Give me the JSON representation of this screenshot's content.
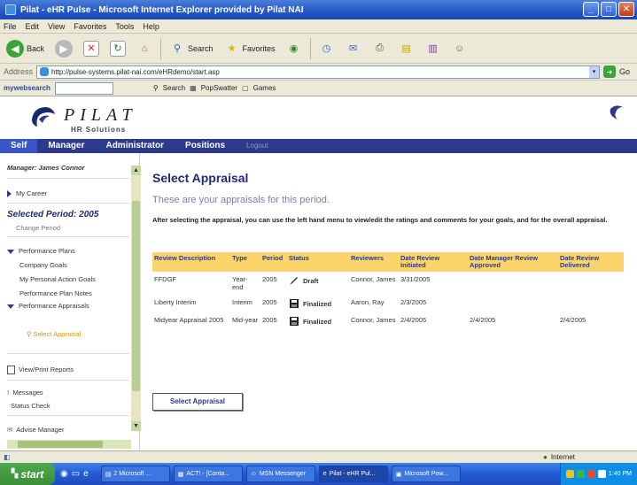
{
  "window": {
    "title": "Pilat - eHR Pulse - Microsoft Internet Explorer provided by Pilat NAI",
    "min_label": "_",
    "max_label": "□",
    "close_label": "✕"
  },
  "menu": [
    "File",
    "Edit",
    "View",
    "Favorites",
    "Tools",
    "Help"
  ],
  "toolbar": {
    "back_label": "Back",
    "search_label": "Search",
    "favorites_label": "Favorites"
  },
  "address": {
    "label": "Address",
    "url": "http://pulse-systems.pilat-nai.com/eHRdemo/start.asp",
    "go_label": "Go"
  },
  "searchbar": {
    "brand": "mywebsearch",
    "search_label": "Search",
    "popswatter_label": "PopSwatter",
    "games_label": "Games"
  },
  "brand": {
    "name": "PILAT",
    "sub": "HR Solutions"
  },
  "nav": {
    "items": [
      "Self",
      "Manager",
      "Administrator",
      "Positions"
    ],
    "logout": "Logout"
  },
  "sidebar": {
    "manager": "Manager: James Connor",
    "my_career": "My Career",
    "selected_period": "Selected Period: 2005",
    "change_period": "Change Period",
    "performance_plans": "Performance Plans",
    "company_goals": "Company Goals",
    "personal_action_goals": "My Personal Action Goals",
    "plan_notes": "Performance Plan Notes",
    "performance_appraisals": "Performance Appraisals",
    "select_appraisal": "Select Appraisal",
    "view_print_reports": "View/Print Reports",
    "messages": "Messages",
    "status_check": "Status Check",
    "advise_manager": "Advise Manager"
  },
  "main": {
    "title": "Select Appraisal",
    "subtitle": "These are your appraisals for this period.",
    "instructions": "After selecting the appraisal, you can use the left hand menu to view/edit the ratings and comments for your goals, and for the overall appraisal.",
    "columns": [
      "Review Description",
      "Type",
      "Period",
      "Status",
      "Reviewers",
      "Date Review Initiated",
      "Date Manager Review Approved",
      "Date Review Delivered"
    ],
    "rows": [
      {
        "description": "FFDGF",
        "type": "Year-end",
        "period": "2005",
        "status": "Draft",
        "status_icon": "pencil-icon",
        "reviewers": "Connor, James",
        "initiated": "3/31/2005",
        "approved": "",
        "delivered": ""
      },
      {
        "description": "Liberty Interim",
        "type": "Interim",
        "period": "2005",
        "status": "Finalized",
        "status_icon": "floppy-icon",
        "reviewers": "Aaron, Ray",
        "initiated": "2/3/2005",
        "approved": "",
        "delivered": ""
      },
      {
        "description": "Midyear Appraisal 2005",
        "type": "Mid-year",
        "period": "2005",
        "status": "Finalized",
        "status_icon": "floppy-icon",
        "reviewers": "Connor, James",
        "initiated": "2/4/2005",
        "approved": "2/4/2005",
        "delivered": "2/4/2005"
      }
    ],
    "select_button": "Select Appraisal"
  },
  "statusbar": {
    "zone": "Internet"
  },
  "taskbar": {
    "start": "start",
    "items": [
      "2 Microsoft ...",
      "ACT! - [Conta...",
      "MSN Messenger",
      "Pilat - eHR Pul...",
      "Microsoft Pow..."
    ],
    "clock": "1:40 PM"
  },
  "colors": {
    "nav_bg": "#2c3a8c",
    "nav_active": "#3656c9",
    "table_header": "#fbd46a",
    "title_blue": "#1d2b72"
  }
}
